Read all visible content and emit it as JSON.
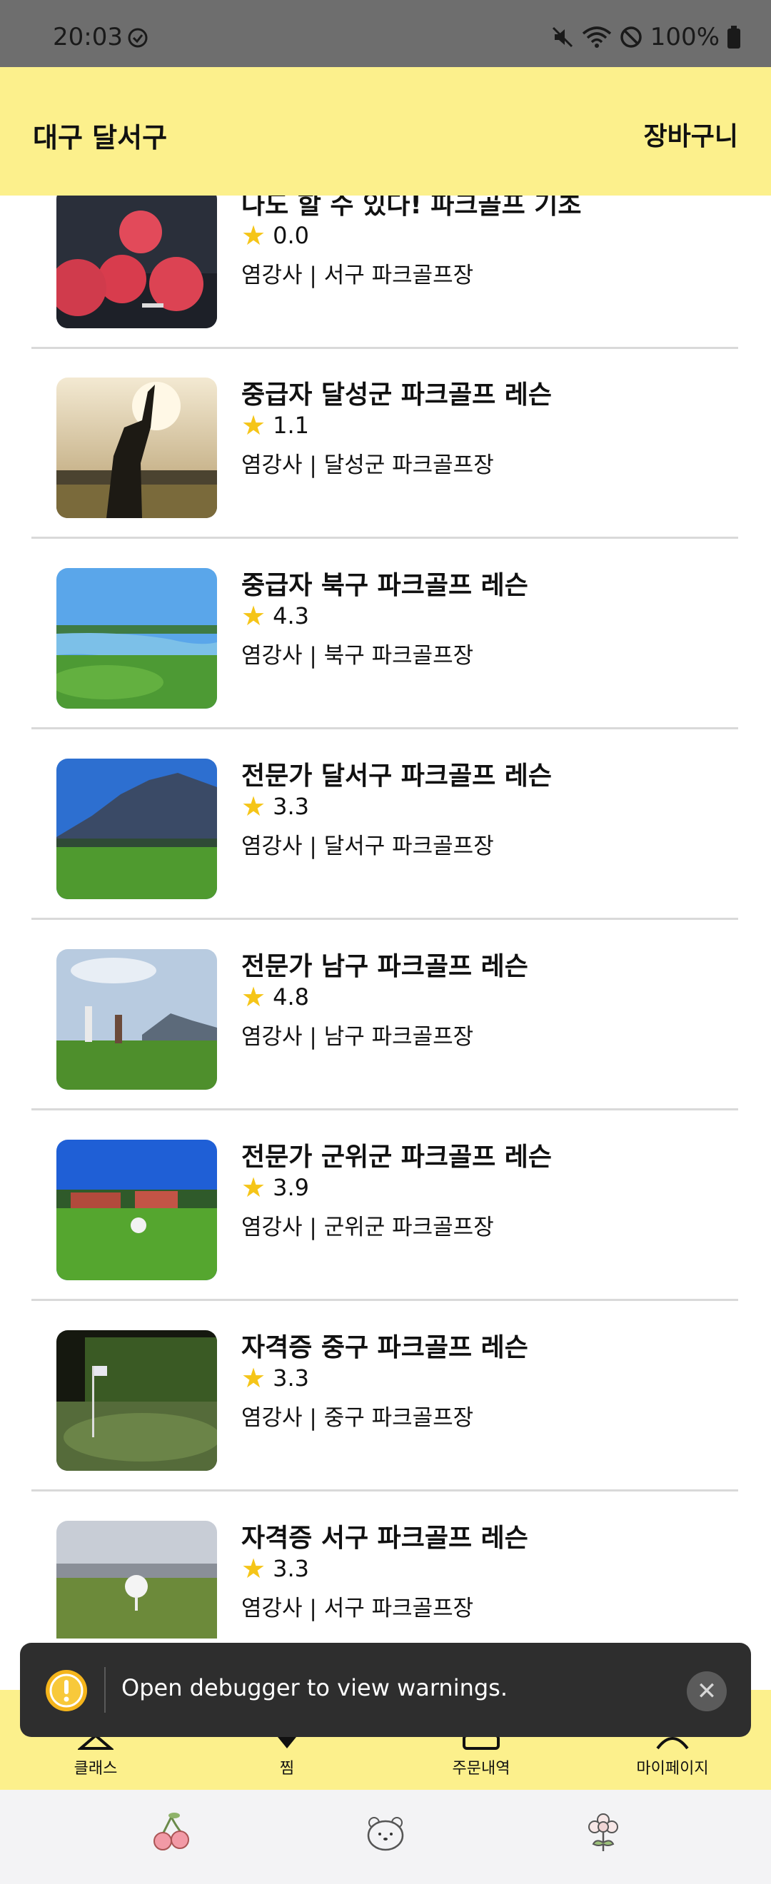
{
  "status_bar": {
    "time": "20:03",
    "battery": "100%"
  },
  "header": {
    "location": "대구 달서구",
    "cart": "장바구니"
  },
  "lessons": [
    {
      "title": "나도 할 수 있다! 파크골프 기초",
      "rating": "0.0",
      "subtitle": "염강사 | 서구 파크골프장",
      "image": "red-golf-balls"
    },
    {
      "title": "중급자 달성군 파크골프 레슨",
      "rating": "1.1",
      "subtitle": "염강사 | 달성군 파크골프장",
      "image": "golfer-sunset"
    },
    {
      "title": "중급자 북구 파크골프 레슨",
      "rating": "4.3",
      "subtitle": "염강사 | 북구 파크골프장",
      "image": "golf-course-lake"
    },
    {
      "title": "전문가 달서구 파크골프 레슨",
      "rating": "3.3",
      "subtitle": "염강사 | 달서구 파크골프장",
      "image": "golf-course-mountains"
    },
    {
      "title": "전문가 남구 파크골프 레슨",
      "rating": "4.8",
      "subtitle": "염강사 | 남구 파크골프장",
      "image": "golfers-on-course"
    },
    {
      "title": "전문가 군위군 파크골프 레슨",
      "rating": "3.9",
      "subtitle": "염강사 | 군위군 파크골프장",
      "image": "ball-on-green"
    },
    {
      "title": "자격증 중구 파크골프 레슨",
      "rating": "3.3",
      "subtitle": "염강사 | 중구 파크골프장",
      "image": "green-with-flag"
    },
    {
      "title": "자격증 서구 파크골프 레슨",
      "rating": "3.3",
      "subtitle": "염강사 | 서구 파크골프장",
      "image": "ball-on-tee"
    }
  ],
  "bottom_nav": [
    {
      "label": "클래스",
      "icon": "class-icon"
    },
    {
      "label": "찜",
      "icon": "heart-icon"
    },
    {
      "label": "주문내역",
      "icon": "order-icon"
    },
    {
      "label": "마이페이지",
      "icon": "profile-icon"
    }
  ],
  "system_nav": [
    {
      "icon": "cherry-icon"
    },
    {
      "icon": "bear-icon"
    },
    {
      "icon": "flower-icon"
    }
  ],
  "toast": {
    "message": "Open debugger to view warnings.",
    "icon": "warning-icon",
    "close_icon": "close-icon"
  },
  "colors": {
    "header_bg": "#fcf08c",
    "status_bar_bg": "#6e6e6e",
    "toast_bg": "#2e2e2e",
    "star": "#f5c518"
  }
}
